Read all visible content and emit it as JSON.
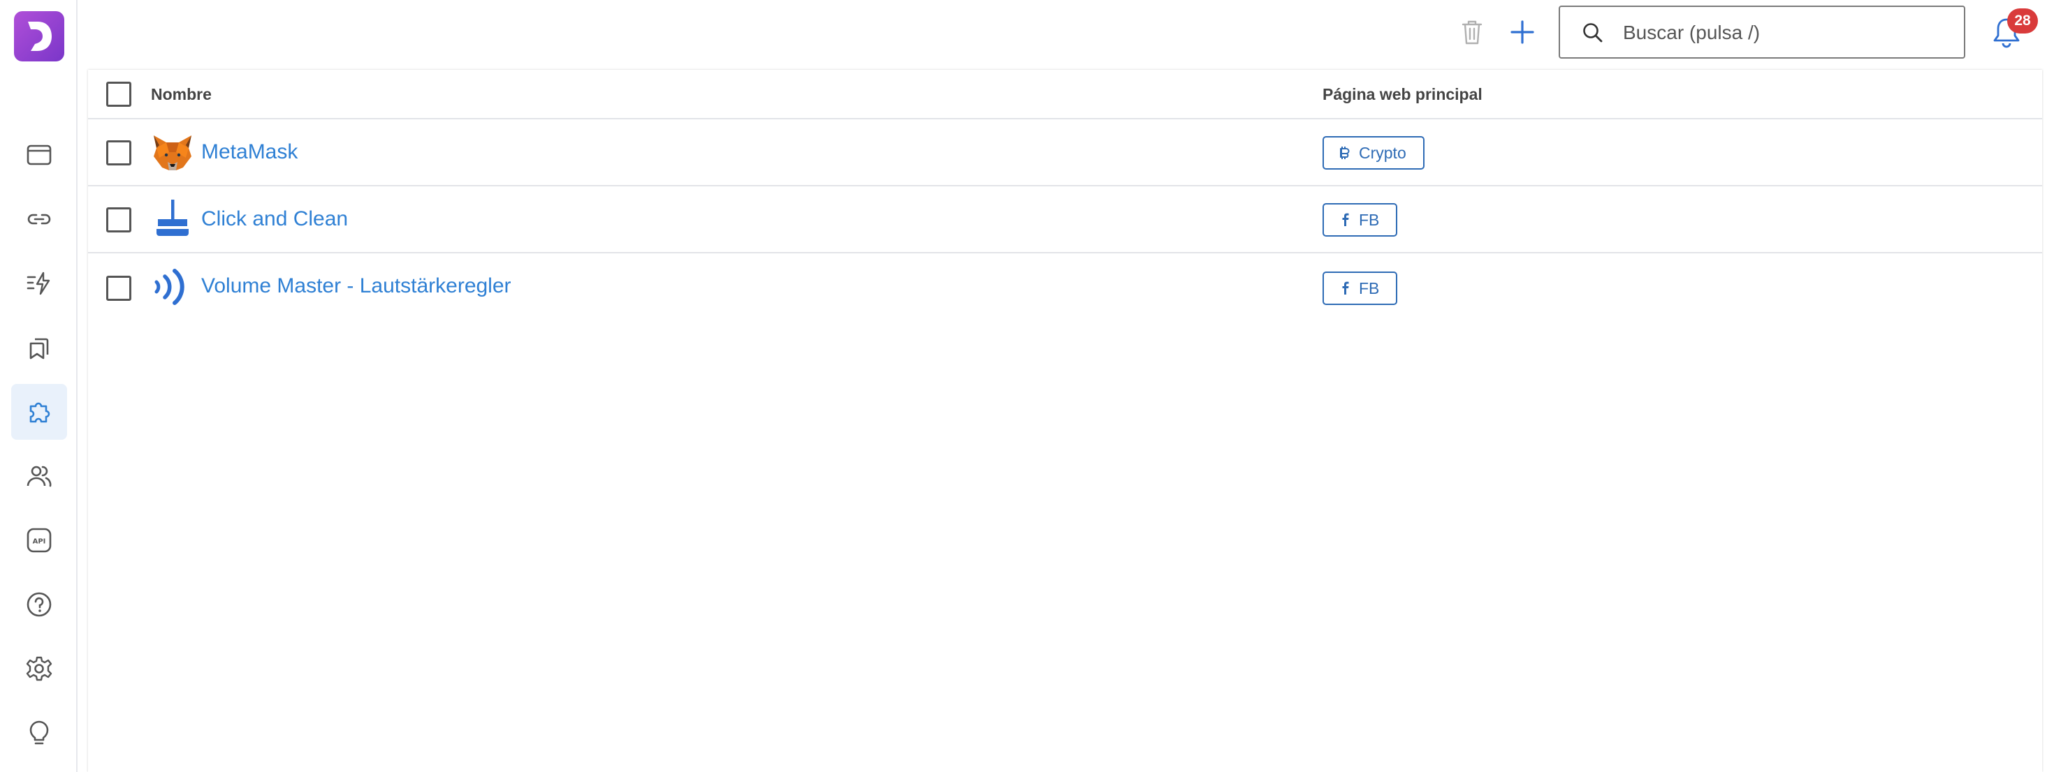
{
  "app": {
    "logo_letter": "D",
    "brand_color": "#8b3fd0"
  },
  "sidebar": {
    "items": [
      {
        "icon": "browser-window-icon",
        "active": false
      },
      {
        "icon": "link-icon",
        "active": false
      },
      {
        "icon": "automation-icon",
        "active": false
      },
      {
        "icon": "bookmarks-icon",
        "active": false
      },
      {
        "icon": "puzzle-extension-icon",
        "active": true
      },
      {
        "icon": "users-icon",
        "active": false
      },
      {
        "icon": "api-icon",
        "active": false
      },
      {
        "icon": "help-icon",
        "active": false
      },
      {
        "icon": "gear-icon",
        "active": false
      },
      {
        "icon": "lightbulb-icon",
        "active": false
      }
    ]
  },
  "header": {
    "search_placeholder": "Buscar (pulsa /)",
    "notification_count": "28"
  },
  "table": {
    "columns": {
      "name": "Nombre",
      "homepage": "Página web principal"
    },
    "rows": [
      {
        "name": "MetaMask",
        "icon": "metamask-fox-icon",
        "tag": "Crypto",
        "tag_icon": "bitcoin-icon"
      },
      {
        "name": "Click and Clean",
        "icon": "broom-icon",
        "tag": "FB",
        "tag_icon": "facebook-icon"
      },
      {
        "name": "Volume Master - Lautstärkeregler",
        "icon": "volume-waves-icon",
        "tag": "FB",
        "tag_icon": "facebook-icon"
      }
    ]
  },
  "colors": {
    "accent": "#2f80d4",
    "badge": "#d93b3b",
    "active_nav": "#e9f1fb"
  }
}
